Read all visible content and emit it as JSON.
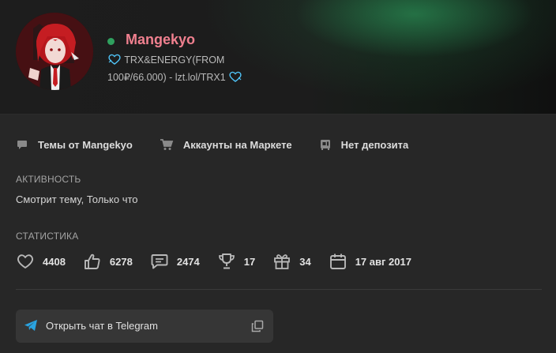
{
  "profile": {
    "username": "Mangekyo",
    "online": true,
    "status_line1": "TRX&ENERGY(FROM",
    "status_line2": "100₽/66.000) - lzt.lol/TRX1",
    "status_icon": "heart-outline-icon"
  },
  "links": [
    {
      "label": "Темы от Mangekyo",
      "icon": "chat-bubble-icon"
    },
    {
      "label": "Аккаунты на Маркете",
      "icon": "cart-icon"
    },
    {
      "label": "Нет депозита",
      "icon": "deposit-icon"
    }
  ],
  "activity": {
    "title": "АКТИВНОСТЬ",
    "text": "Смотрит тему, Только что"
  },
  "stats": {
    "title": "СТАТИСТИКА",
    "likes": "4408",
    "thumbs": "6278",
    "messages": "2474",
    "trophies": "17",
    "gifts": "34",
    "joined": "17 авг 2017"
  },
  "telegram": {
    "label": "Открыть чат в Telegram"
  },
  "colors": {
    "username": "#f0808f",
    "online": "#2fa05e",
    "telegram": "#2aa3e0",
    "status_heart": "#4fc3f7"
  }
}
